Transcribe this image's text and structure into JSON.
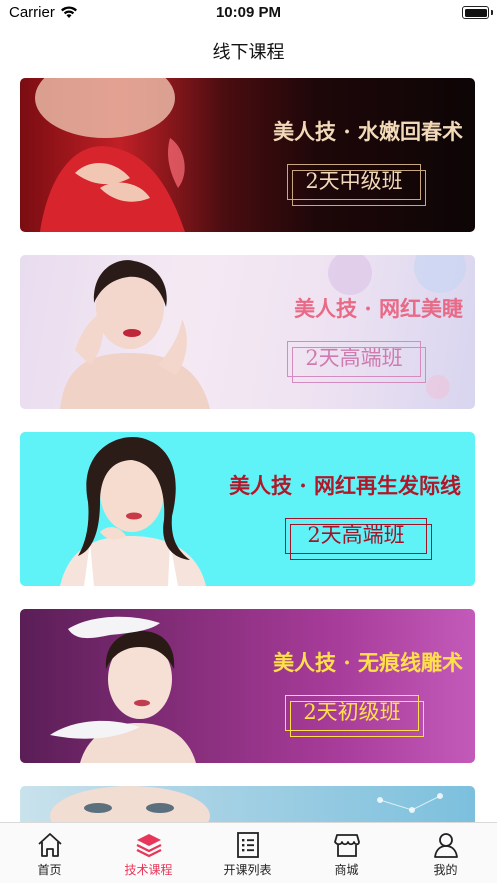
{
  "status_bar": {
    "carrier": "Carrier",
    "time": "10:09 PM"
  },
  "nav": {
    "title": "线下课程"
  },
  "courses": [
    {
      "headline": "美人技 · 水嫩回春术",
      "badge": "2天中级班"
    },
    {
      "headline": "美人技 · 网红美睫",
      "badge": "2天高端班"
    },
    {
      "headline": "美人技 · 网红再生发际线",
      "badge": "2天高端班"
    },
    {
      "headline": "美人技 · 无痕线雕术",
      "badge": "2天初级班"
    }
  ],
  "tabs": [
    {
      "label": "首页",
      "icon": "home-icon"
    },
    {
      "label": "技术课程",
      "icon": "layers-icon",
      "active": true
    },
    {
      "label": "开课列表",
      "icon": "list-icon"
    },
    {
      "label": "商城",
      "icon": "shop-icon"
    },
    {
      "label": "我的",
      "icon": "user-icon"
    }
  ],
  "colors": {
    "accent": "#e8365a",
    "tab_inactive": "#222222"
  }
}
